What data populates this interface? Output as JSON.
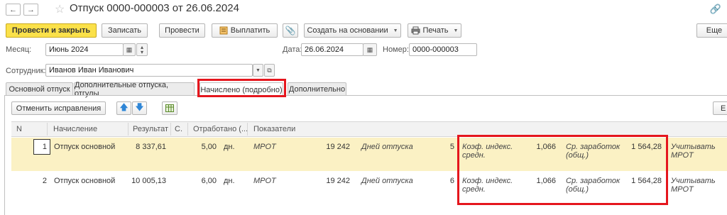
{
  "window": {
    "title": "Отпуск 0000-000003 от 26.06.2024",
    "back_icon": "←",
    "forward_icon": "→"
  },
  "toolbar": {
    "post_close": "Провести и закрыть",
    "save": "Записать",
    "post": "Провести",
    "pay": "Выплатить",
    "create_based": "Создать на основании",
    "print": "Печать",
    "more": "Еще"
  },
  "fields": {
    "month_label": "Месяц:",
    "month_value": "Июнь 2024",
    "date_label": "Дата:",
    "date_value": "26.06.2024",
    "number_label": "Номер:",
    "number_value": "0000-000003",
    "employee_label": "Сотрудник:",
    "employee_value": "Иванов Иван Иванович"
  },
  "tabs": [
    {
      "label": "Основной отпуск"
    },
    {
      "label": "Дополнительные отпуска, отгулы"
    },
    {
      "label": "Начислено (подробно)"
    },
    {
      "label": "Дополнительно"
    }
  ],
  "subtoolbar": {
    "cancel_corrections": "Отменить исправления",
    "right_btn": "Е"
  },
  "table": {
    "headers": {
      "n": "N",
      "accrual": "Начисление",
      "result": "Результат",
      "c": "С.",
      "worked": "Отработано (...",
      "indicators": "Показатели"
    },
    "rows": [
      {
        "n": "1",
        "accrual": "Отпуск основной",
        "result": "8 337,61",
        "worked": "5,00",
        "unit": "дн.",
        "ind1_name": "МРОТ",
        "ind1_value": "19 242",
        "ind2_name": "Дней отпуска",
        "ind2_value": "5",
        "ind3_name_1": "Коэф. индекс.",
        "ind3_name_2": "средн.",
        "ind3_value": "1,066",
        "ind4_name_1": "Ср. заработок",
        "ind4_name_2": "(общ.)",
        "ind4_value": "1 564,28",
        "ind5_name_1": "Учитывать",
        "ind5_name_2": "МРОТ"
      },
      {
        "n": "2",
        "accrual": "Отпуск основной",
        "result": "10 005,13",
        "worked": "6,00",
        "unit": "дн.",
        "ind1_name": "МРОТ",
        "ind1_value": "19 242",
        "ind2_name": "Дней отпуска",
        "ind2_value": "6",
        "ind3_name_1": "Коэф. индекс.",
        "ind3_name_2": "средн.",
        "ind3_value": "1,066",
        "ind4_name_1": "Ср. заработок",
        "ind4_name_2": "(общ.)",
        "ind4_value": "1 564,28",
        "ind5_name_1": "Учитывать",
        "ind5_name_2": "МРОТ"
      }
    ]
  },
  "colors": {
    "primary_button": "#fbe14a",
    "selected_row": "#fbf1c4",
    "highlight_frame": "#e5161d"
  }
}
